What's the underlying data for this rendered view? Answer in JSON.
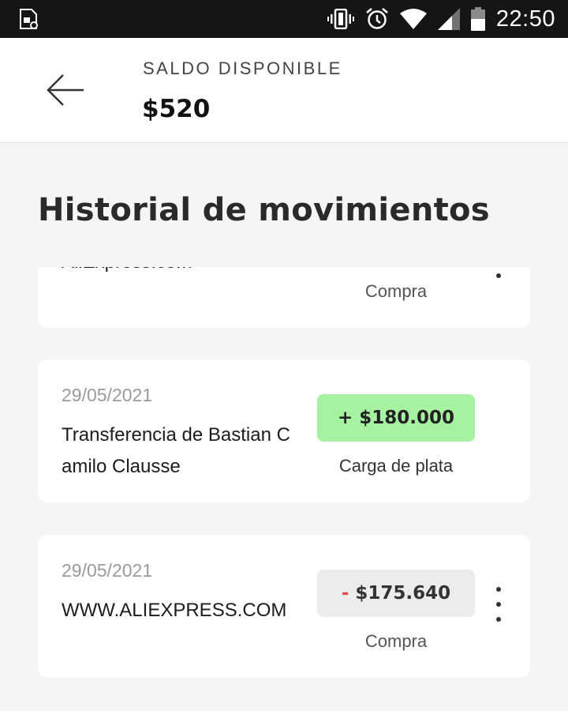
{
  "status_bar": {
    "time": "22:50",
    "icons": [
      "sim-settings-icon",
      "vibrate-icon",
      "alarm-icon",
      "wifi-icon",
      "signal-icon",
      "battery-icon"
    ]
  },
  "header": {
    "back_icon": "arrow-left-icon",
    "saldo_label": "SALDO DISPONIBLE",
    "saldo_amount": "$520"
  },
  "page_title": "Historial de movimientos",
  "transactions": [
    {
      "date": "",
      "description": "AliExpress.com",
      "amount_sign": "",
      "amount": "",
      "type": "Compra",
      "kind": "debit",
      "has_menu": true
    },
    {
      "date": "29/05/2021",
      "description": "Transferencia de Bastian Camilo Clausse",
      "amount_sign": "+",
      "amount": "$180.000",
      "type": "Carga de plata",
      "kind": "credit",
      "has_menu": false
    },
    {
      "date": "29/05/2021",
      "description": "WWW.ALIEXPRESS.COM",
      "amount_sign": "-",
      "amount": "$175.640",
      "type": "Compra",
      "kind": "debit",
      "has_menu": true
    }
  ],
  "colors": {
    "credit_bg": "#a6f2a1",
    "debit_bg": "#ececec",
    "minus_sign": "#e54b4b",
    "status_bar_bg": "#151515"
  }
}
